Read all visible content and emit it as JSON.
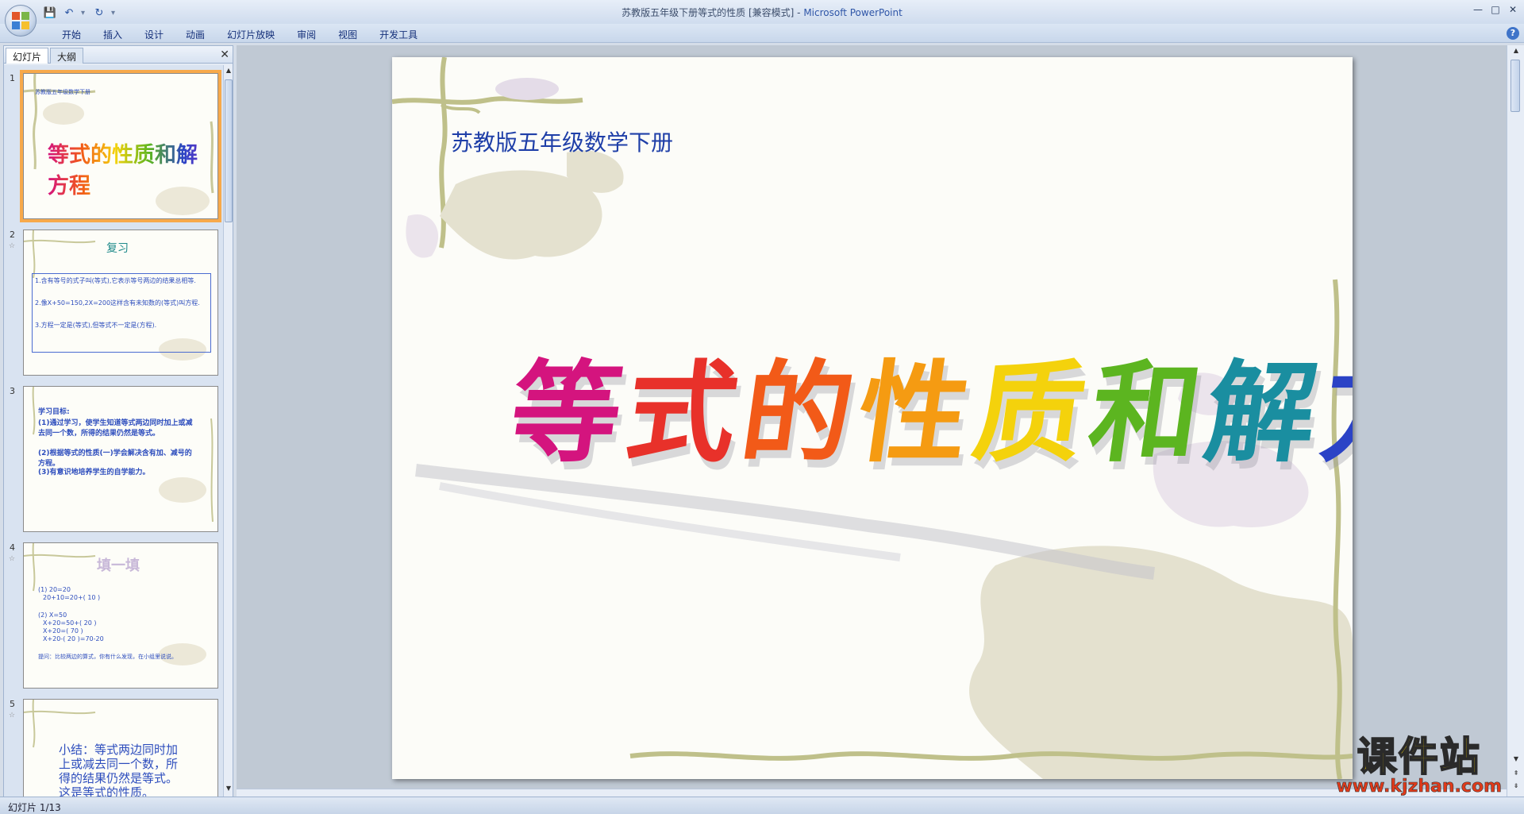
{
  "window": {
    "title": "苏教版五年级下册等式的性质 [兼容模式]",
    "title_sep": " - ",
    "app": "Microsoft PowerPoint",
    "controls": [
      "—",
      "□",
      "✕"
    ]
  },
  "ribbon": {
    "tabs": [
      "开始",
      "插入",
      "设计",
      "动画",
      "幻灯片放映",
      "审阅",
      "视图",
      "开发工具"
    ],
    "help": "?"
  },
  "left_pane": {
    "tabs": [
      "幻灯片",
      "大纲"
    ],
    "close": "✕"
  },
  "thumbnails": [
    {
      "number": "1",
      "small_title": "苏教版五年级数学下册",
      "title": "等式的性质和解方程"
    },
    {
      "number": "2",
      "title": "复习",
      "lines": [
        "1.含有等号的式子叫(等式),它表示等号两边的结果总相等.",
        "2.像X+50=150,2X=200这样含有未知数的(等式)叫方程.",
        "3.方程一定是(等式),但等式不一定是(方程)."
      ]
    },
    {
      "number": "3",
      "lines": [
        "学习目标:",
        "(1)通过学习，使学生知道等式两边同时加上或减去同一个数，所得的结果仍然是等式。",
        "(2)根据等式的性质(一)学会解决含有加、减号的方程。",
        "(3)有意识地培养学生的自学能力。"
      ]
    },
    {
      "number": "4",
      "title": "填一填",
      "lines": [
        "(1) 20=20",
        "20+10=20+( 10 )",
        "(2) X=50",
        "X+20=50+( 20 )",
        "X+20=( 70 )",
        "X+20-( 20 )=70-20",
        "提问：比较两边的算式，你有什么发现，在小组里说说。"
      ]
    },
    {
      "number": "5",
      "lines": [
        "小结：等式两边同时加",
        "上或减去同一个数，所",
        "得的结果仍然是等式。",
        "这是等式的性质。"
      ]
    }
  ],
  "slide": {
    "subtitle": "苏教版五年级数学下册",
    "title_chars": [
      "等",
      "式",
      "的",
      "性",
      "质",
      "和",
      "解",
      "方",
      "程"
    ],
    "title_colors": [
      "#d4147e",
      "#e8312a",
      "#f25a18",
      "#f59b12",
      "#f4d20c",
      "#5cb520",
      "#1a8ea0",
      "#2b43c6",
      "#8a2ac4"
    ]
  },
  "status": {
    "slide_counter": "幻灯片 1/13"
  },
  "watermark": {
    "main": "课件站",
    "url": "www.kjzhan.com"
  }
}
